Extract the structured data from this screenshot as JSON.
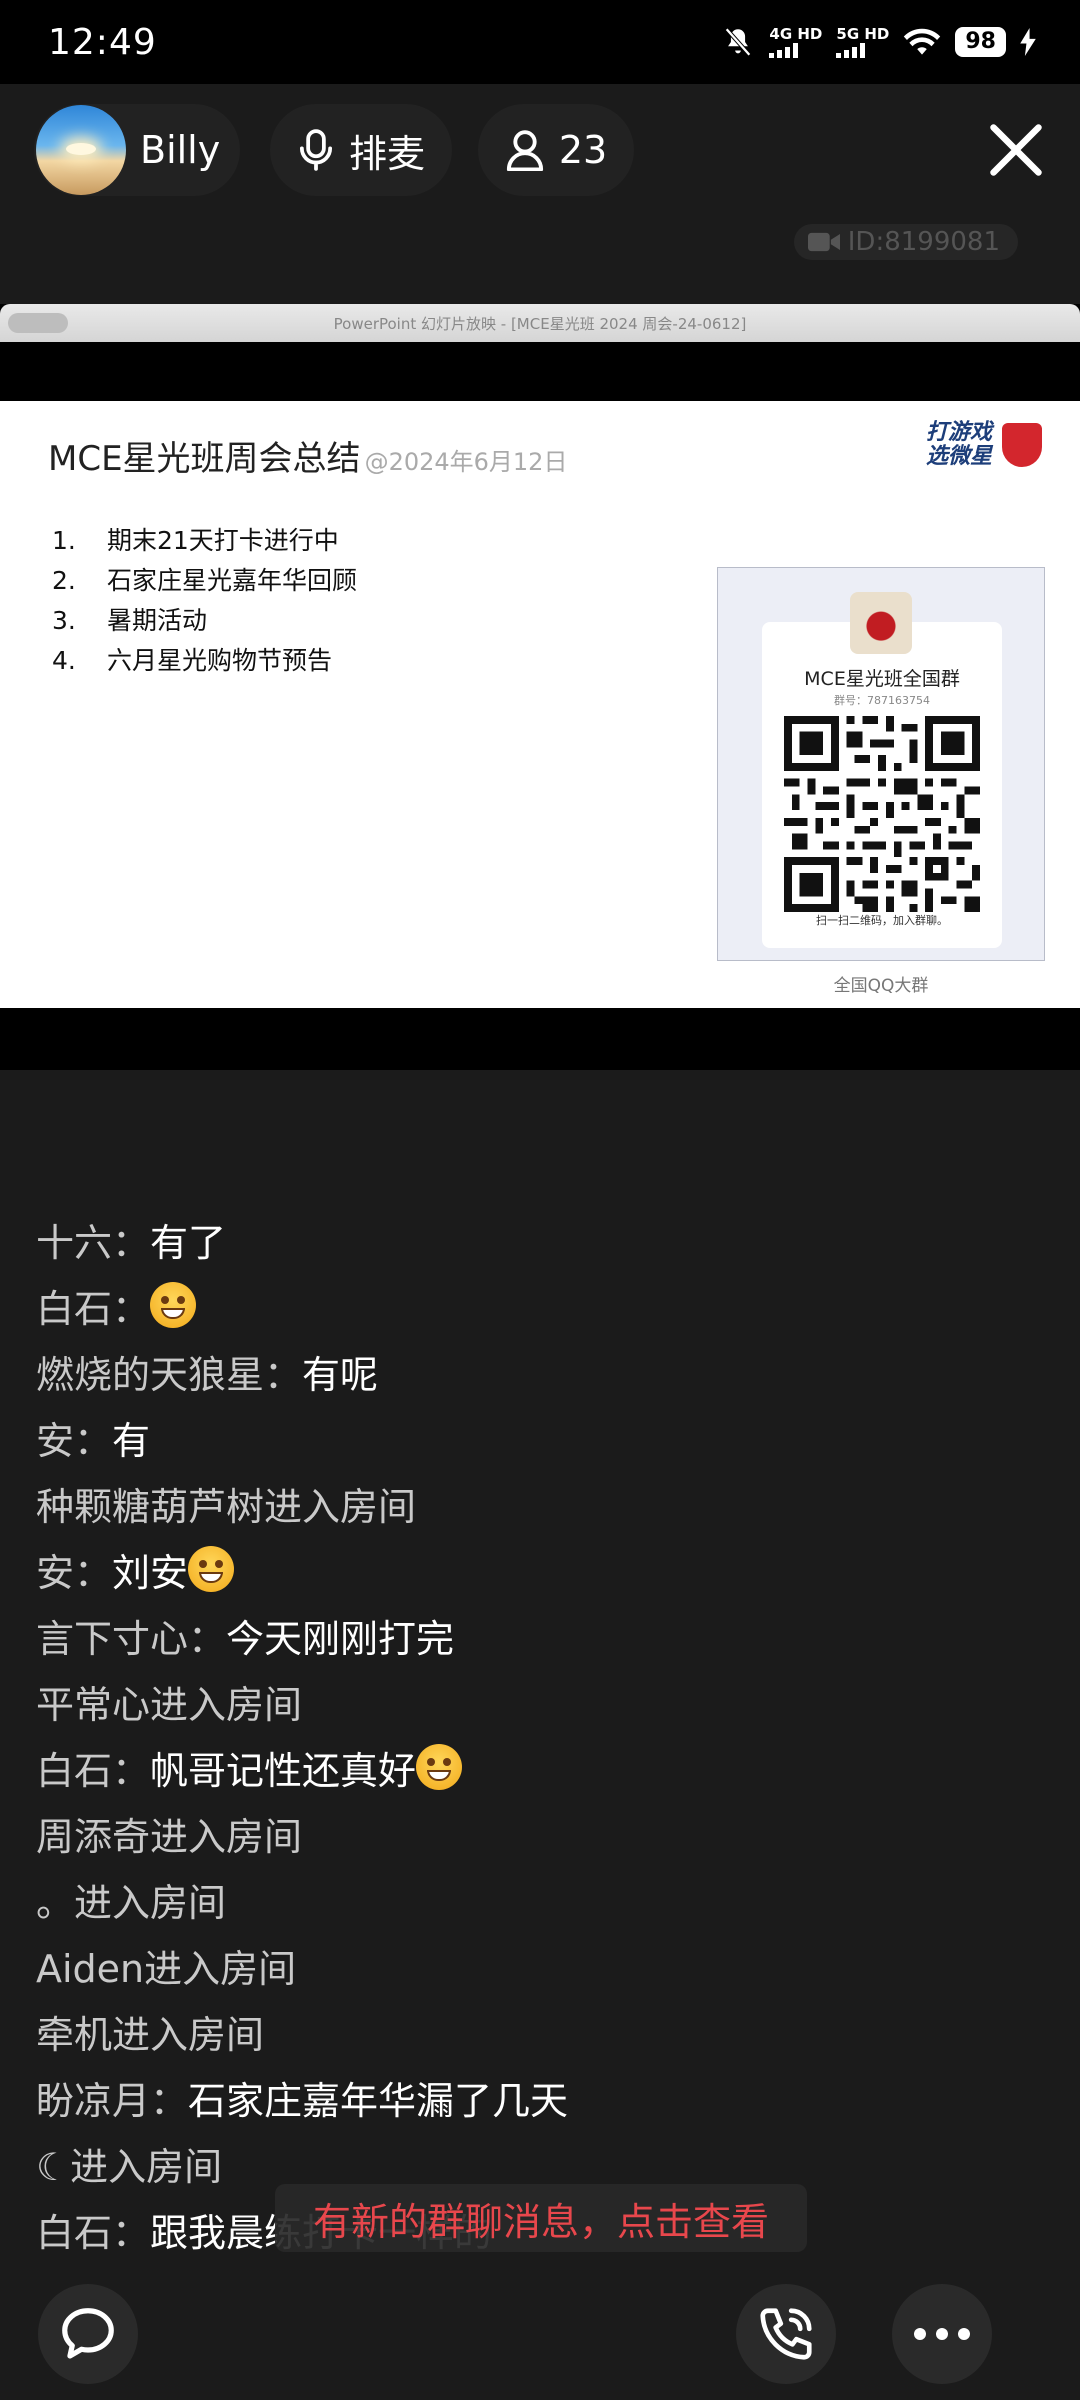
{
  "status_bar": {
    "time": "12:49",
    "net1": "4G HD",
    "net2": "5G HD",
    "battery": "98"
  },
  "header": {
    "username": "Billy",
    "mic_label": "排麦",
    "audience_count": "23",
    "room_id": "ID:8199081"
  },
  "slide": {
    "window_title": "PowerPoint 幻灯片放映 - [MCE星光班 2024 周会-24-0612]",
    "title": "MCE星光班周会总结",
    "date": "@2024年6月12日",
    "brand_line1": "打游戏",
    "brand_line2": "选微星",
    "agenda": [
      {
        "num": "1.",
        "text": "期末21天打卡进行中"
      },
      {
        "num": "2.",
        "text": "石家庄星光嘉年华回顾"
      },
      {
        "num": "3.",
        "text": "暑期活动"
      },
      {
        "num": "4.",
        "text": "六月星光购物节预告"
      }
    ],
    "qr": {
      "group_name": "MCE星光班全国群",
      "group_number": "群号：787163754",
      "caption": "扫一扫二维码，加入群聊。",
      "label": "全国QQ大群"
    }
  },
  "chat": [
    {
      "nick": "十六：",
      "text": "有了",
      "emoji": false
    },
    {
      "nick": "白石：",
      "text": "",
      "emoji": true
    },
    {
      "nick": "燃烧的天狼星：",
      "text": "有呢",
      "emoji": false
    },
    {
      "nick": "安：",
      "text": "有",
      "emoji": false
    },
    {
      "nick": "种颗糖葫芦树进入房间",
      "text": "",
      "emoji": false
    },
    {
      "nick": "安：",
      "text": "刘安",
      "emoji": true
    },
    {
      "nick": "言下寸心：",
      "text": "今天刚刚打完",
      "emoji": false
    },
    {
      "nick": "平常心进入房间",
      "text": "",
      "emoji": false
    },
    {
      "nick": "白石：",
      "text": "帆哥记性还真好",
      "emoji": true
    },
    {
      "nick": "周添奇进入房间",
      "text": "",
      "emoji": false
    },
    {
      "nick": "。进入房间",
      "text": "",
      "emoji": false
    },
    {
      "nick": "Aiden进入房间",
      "text": "",
      "emoji": false
    },
    {
      "nick": "牵机进入房间",
      "text": "",
      "emoji": false
    },
    {
      "nick": "盼凉月：",
      "text": "石家庄嘉年华漏了几天",
      "emoji": false
    },
    {
      "nick": "☾进入房间",
      "text": "",
      "emoji": false
    },
    {
      "nick": "白石：",
      "text": "跟我晨练打卡一样的",
      "emoji": false
    }
  ],
  "notice": "有新的群聊消息，点击查看",
  "icons": {
    "mic": "microphone-icon",
    "people": "person-icon",
    "close": "close-icon",
    "video": "video-camera-icon",
    "comment": "chat-bubble-icon",
    "call": "phone-icon",
    "more": "more-dots-icon"
  },
  "colors": {
    "notice_text": "#e8474c",
    "background": "#1b1b1b"
  }
}
